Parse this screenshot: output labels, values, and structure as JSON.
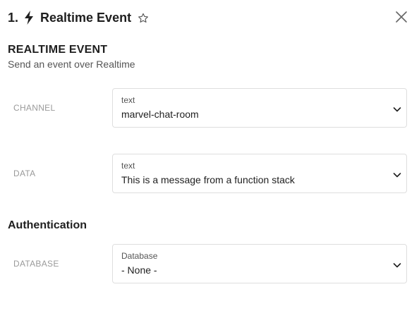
{
  "header": {
    "step_number": "1.",
    "title": "Realtime Event",
    "bolt_icon": "lightning-bolt-icon",
    "star_icon": "star-outline-icon",
    "close_icon": "close-icon"
  },
  "section": {
    "title": "REALTIME EVENT",
    "subtitle": "Send an event over Realtime"
  },
  "fields": [
    {
      "label": "CHANNEL",
      "type": "text",
      "value": "marvel-chat-room"
    },
    {
      "label": "DATA",
      "type": "text",
      "value": "This is a message from a function stack"
    }
  ],
  "authentication": {
    "title": "Authentication",
    "field": {
      "label": "DATABASE",
      "type": "Database",
      "value": "- None -"
    }
  },
  "colors": {
    "text": "#1f1f1f",
    "muted_label": "#9a9a9a",
    "border": "#dedede"
  }
}
